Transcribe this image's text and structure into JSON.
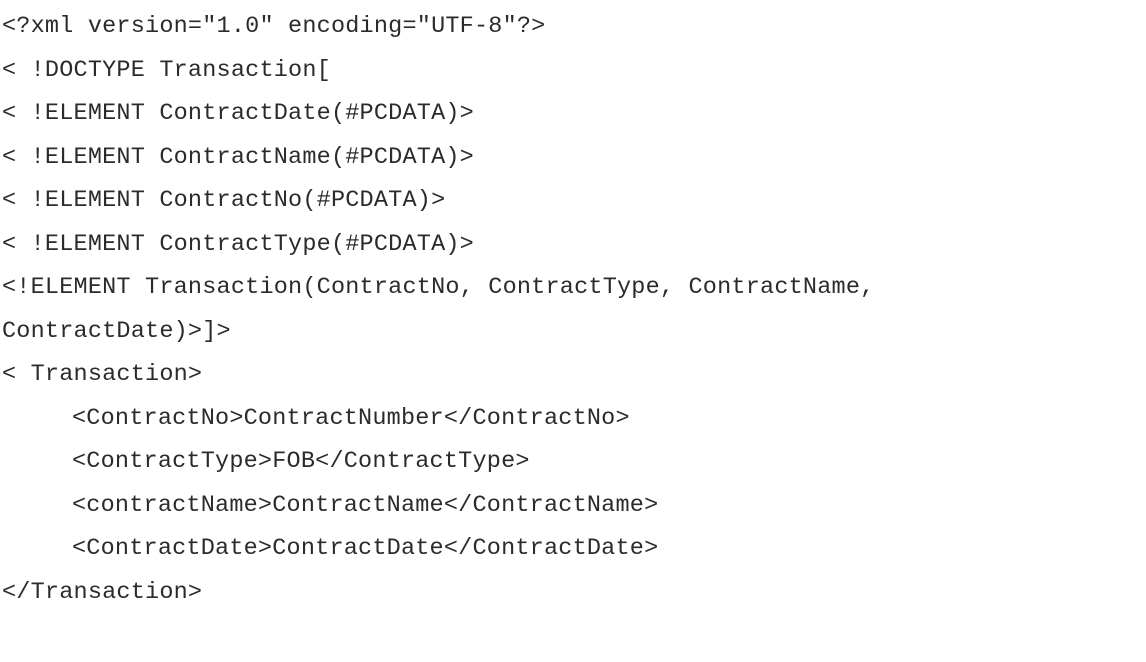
{
  "document": {
    "lines": [
      {
        "text": "<?xml version=\"1.0\" encoding=\"UTF-8\"?>"
      },
      {
        "text": "< !DOCTYPE Transaction["
      },
      {
        "text": "< !ELEMENT ContractDate(#PCDATA)>"
      },
      {
        "text": "< !ELEMENT ContractName(#PCDATA)>"
      },
      {
        "text": "< !ELEMENT ContractNo(#PCDATA)>"
      },
      {
        "text": "< !ELEMENT ContractType(#PCDATA)>"
      },
      {
        "text": "<!ELEMENT Transaction(ContractNo, ContractType, ContractName,"
      },
      {
        "text": "ContractDate)>]>"
      },
      {
        "text": "< Transaction>"
      },
      {
        "text": "<ContractNo>ContractNumber</ContractNo>"
      },
      {
        "text": "<ContractType>FOB</ContractType>"
      },
      {
        "text": "<contractName>ContractName</ContractName>"
      },
      {
        "text": "<ContractDate>ContractDate</ContractDate>"
      },
      {
        "text": "</Transaction>"
      }
    ]
  }
}
